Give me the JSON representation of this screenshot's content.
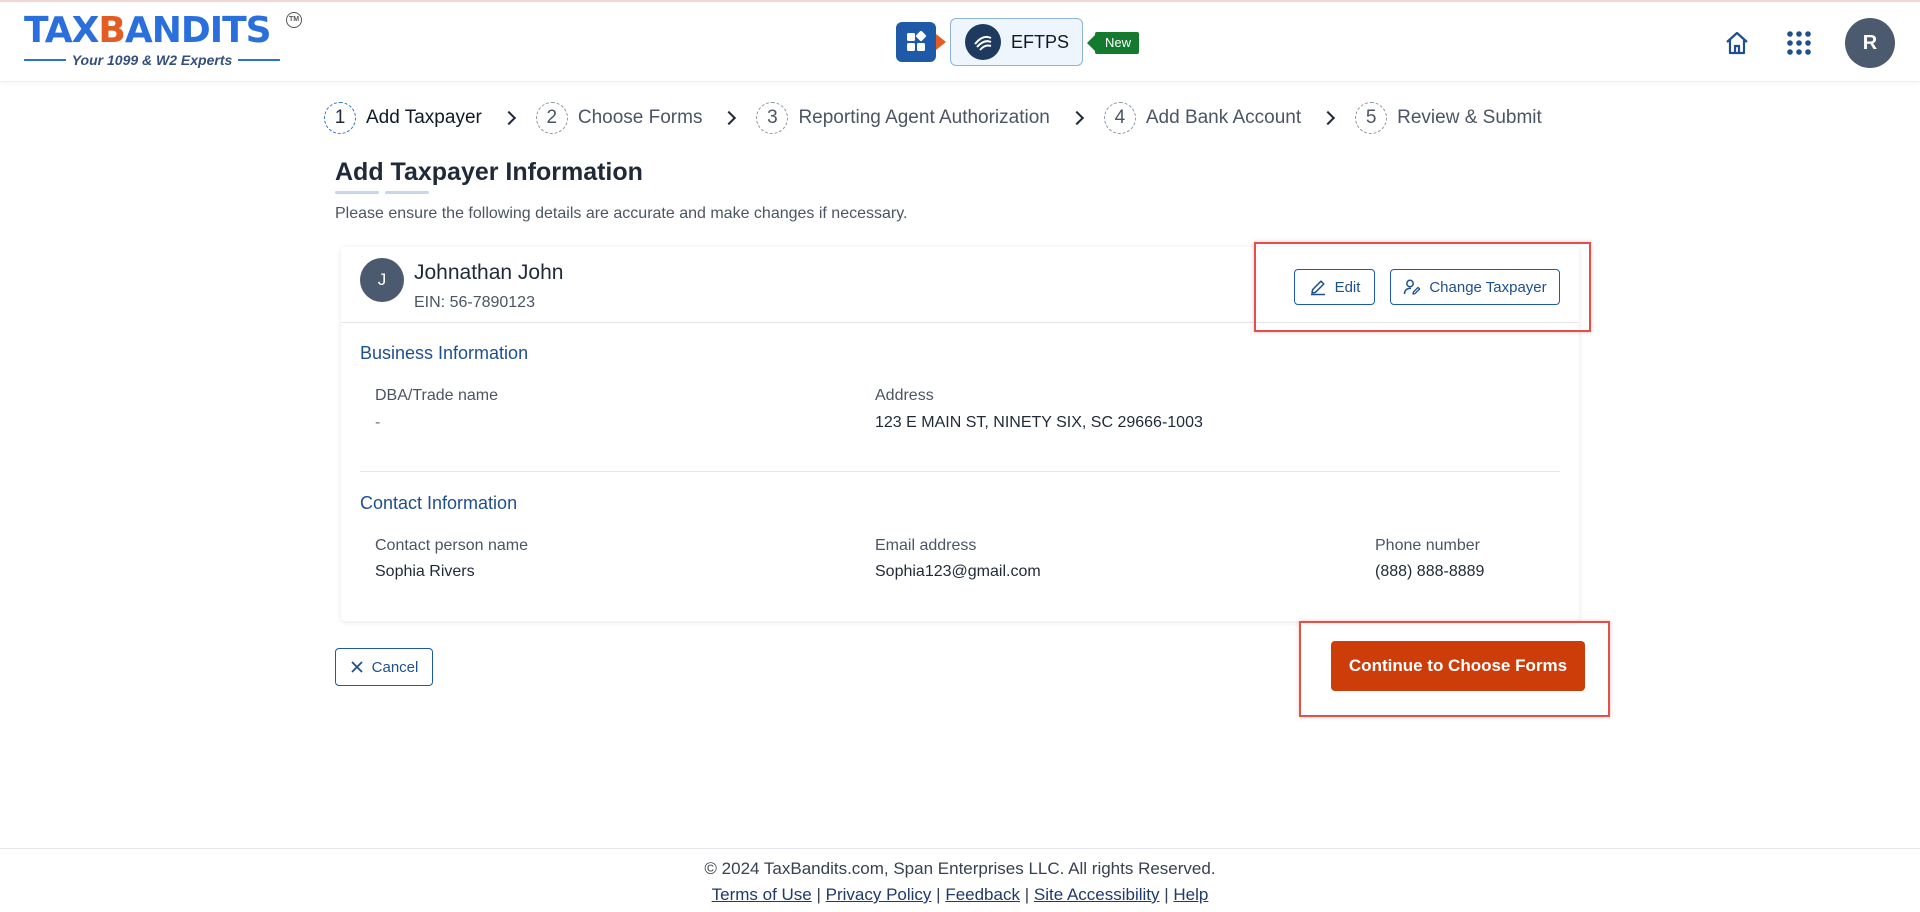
{
  "header": {
    "logo": {
      "main_left": "TAX",
      "main_owl": "👓",
      "main_right": "ANDITS",
      "tm": "TM",
      "tagline": "Your 1099 & W2 Experts"
    },
    "product_button": "EFTPS",
    "new_badge": "New",
    "avatar_initial": "R"
  },
  "stepper": [
    {
      "num": "1",
      "label": "Add Taxpayer"
    },
    {
      "num": "2",
      "label": "Choose Forms"
    },
    {
      "num": "3",
      "label": "Reporting Agent Authorization"
    },
    {
      "num": "4",
      "label": "Add Bank Account"
    },
    {
      "num": "5",
      "label": "Review & Submit"
    }
  ],
  "page": {
    "title": "Add Taxpayer Information",
    "subtitle": "Please ensure the following details are accurate and make changes if necessary."
  },
  "taxpayer": {
    "initial": "J",
    "name": "Johnathan John",
    "ein": "EIN: 56-7890123",
    "edit_label": "Edit",
    "change_label": "Change Taxpayer"
  },
  "business": {
    "title": "Business Information",
    "dba_label": "DBA/Trade name",
    "dba_value": "-",
    "address_label": "Address",
    "address_value": "123 E MAIN ST, NINETY SIX, SC 29666-1003"
  },
  "contact": {
    "title": "Contact Information",
    "person_label": "Contact person name",
    "person_value": "Sophia Rivers",
    "email_label": "Email address",
    "email_value": "Sophia123@gmail.com",
    "phone_label": "Phone number",
    "phone_value": "(888) 888-8889"
  },
  "actions": {
    "cancel": "Cancel",
    "continue": "Continue to Choose Forms"
  },
  "footer": {
    "copyright": "© 2024 TaxBandits.com, Span Enterprises LLC. All rights Reserved.",
    "links": [
      "Terms of Use",
      "Privacy Policy",
      "Feedback",
      "Site Accessibility",
      "Help"
    ],
    "separator": " | "
  },
  "colors": {
    "brand_blue": "#2a6fdb",
    "primary_orange": "#cc3d0a",
    "highlight_red": "#e0514b"
  }
}
